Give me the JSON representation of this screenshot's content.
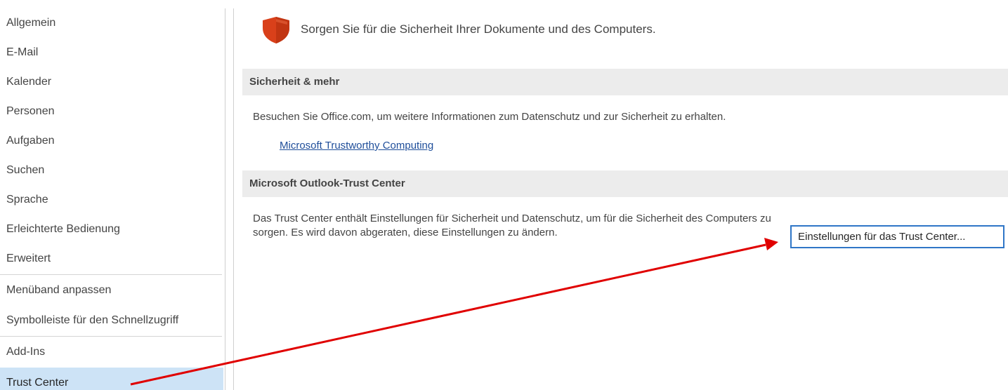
{
  "sidebar": {
    "items": [
      {
        "label": "Allgemein"
      },
      {
        "label": "E-Mail"
      },
      {
        "label": "Kalender"
      },
      {
        "label": "Personen"
      },
      {
        "label": "Aufgaben"
      },
      {
        "label": "Suchen"
      },
      {
        "label": "Sprache"
      },
      {
        "label": "Erleichterte Bedienung"
      },
      {
        "label": "Erweitert"
      },
      {
        "label": "Menüband anpassen"
      },
      {
        "label": "Symbolleiste für den Schnellzugriff"
      },
      {
        "label": "Add-Ins"
      },
      {
        "label": "Trust Center"
      }
    ],
    "selected": "Trust Center"
  },
  "main": {
    "headline": "Sorgen Sie für die Sicherheit Ihrer Dokumente und des Computers.",
    "security_section": {
      "title": "Sicherheit & mehr",
      "description": "Besuchen Sie Office.com, um weitere Informationen zum Datenschutz und zur Sicherheit zu erhalten.",
      "link": "Microsoft Trustworthy Computing"
    },
    "trust_center_section": {
      "title": "Microsoft Outlook-Trust Center",
      "description": "Das Trust Center enthält Einstellungen für Sicherheit und Datenschutz, um für die Sicherheit des Computers zu sorgen. Es wird davon abgeraten, diese Einstellungen zu ändern.",
      "button_label": "Einstellungen für das Trust Center..."
    }
  },
  "colors": {
    "selected_bg": "#cde3f6",
    "section_bg": "#ececec",
    "link": "#1f4e9a",
    "button_border": "#2f76c7",
    "shield": "#d9401a",
    "annotation_arrow": "#e00000"
  },
  "icons": {
    "shield": "shield-icon",
    "arrow": "annotation-arrow"
  }
}
